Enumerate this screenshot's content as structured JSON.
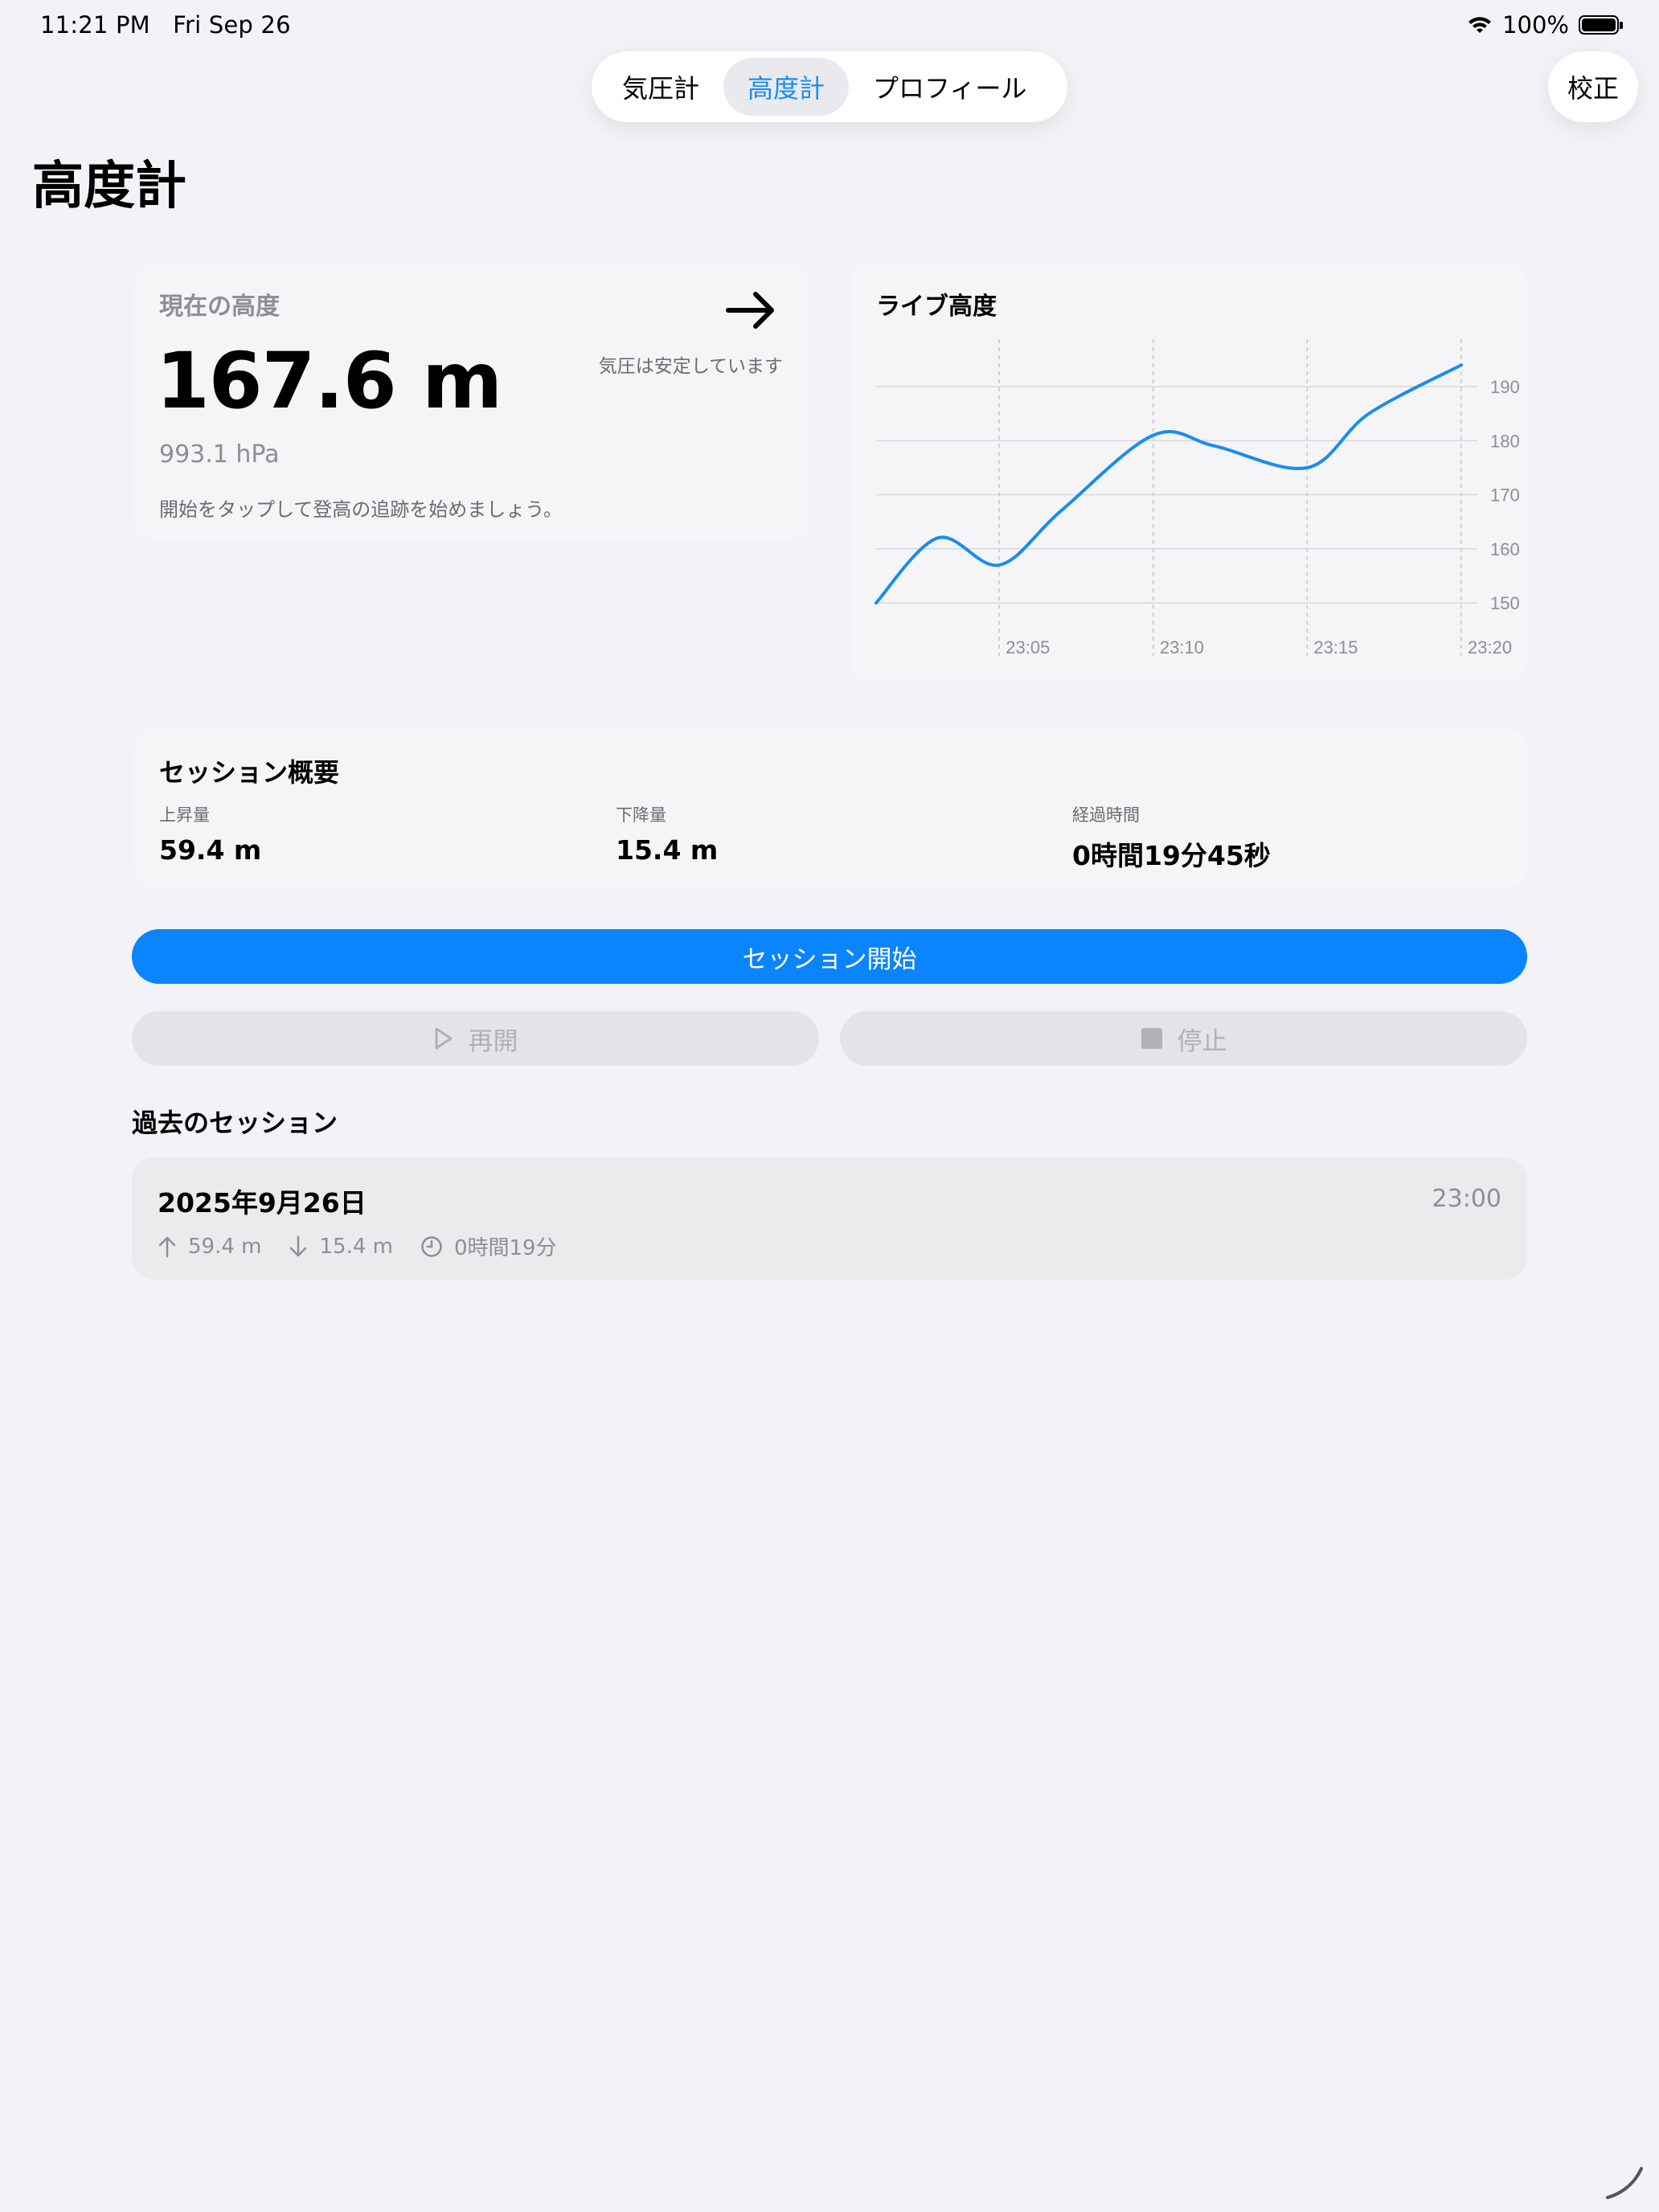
{
  "status_bar": {
    "time": "11:21 PM",
    "date": "Fri Sep 26",
    "battery": "100%"
  },
  "tabs": [
    {
      "label": "気圧計",
      "active": false
    },
    {
      "label": "高度計",
      "active": true
    },
    {
      "label": "プロフィール",
      "active": false
    }
  ],
  "calibrate_label": "校正",
  "page_title": "高度計",
  "current_altitude": {
    "label": "現在の高度",
    "value": "167.6 m",
    "pressure": "993.1 hPa",
    "hint": "開始をタップして登高の追跡を始めましょう。",
    "trend_icon": "arrow-right-icon",
    "trend_text": "気圧は安定しています"
  },
  "live_chart": {
    "title": "ライブ高度",
    "accent": "#1a8cf0"
  },
  "chart_data": {
    "type": "line",
    "x": [
      "23:01",
      "23:03",
      "23:05",
      "23:07",
      "23:10",
      "23:12",
      "23:15",
      "23:17",
      "23:20"
    ],
    "values": [
      150,
      162,
      157,
      167,
      181,
      179,
      175,
      185,
      194
    ],
    "series": [
      {
        "values": [
          150,
          162,
          157,
          167,
          181,
          179,
          175,
          185,
          194
        ]
      }
    ],
    "x_ticks": [
      "23:05",
      "23:10",
      "23:15",
      "23:20"
    ],
    "y_ticks": [
      150,
      160,
      170,
      180,
      190
    ],
    "ylim": [
      150,
      190
    ],
    "grid": true
  },
  "session_summary": {
    "title": "セッション概要",
    "ascent_label": "上昇量",
    "ascent_value": "59.4 m",
    "descent_label": "下降量",
    "descent_value": "15.4 m",
    "elapsed_label": "経過時間",
    "elapsed_value": "0時間19分45秒"
  },
  "buttons": {
    "start": "セッション開始",
    "resume": "再開",
    "stop": "停止"
  },
  "past_sessions": {
    "title": "過去のセッション",
    "items": [
      {
        "date": "2025年9月26日",
        "time": "23:00",
        "ascent": "59.4 m",
        "descent": "15.4 m",
        "duration": "0時間19分"
      }
    ]
  }
}
